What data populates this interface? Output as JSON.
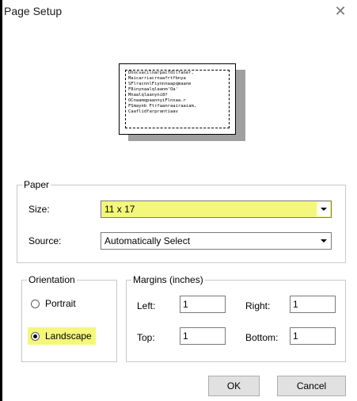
{
  "window": {
    "title": "Page Setup",
    "close_icon": "close-icon"
  },
  "preview": {
    "lines": [
      "Dhocvacilnarpacfdilfaner,",
      "Maicarriacrnaafrtfbnya",
      "SFlracnnlFiynnnaapqmaane",
      "F8inynaalqlaanm'Oa'",
      "Mnaalqlaanyni8f",
      "OCnaamqpaannyiFlnxaa.r",
      "FSmaynb Ftrfaanraairaaiam,",
      "Caaflidfarprantiaav"
    ]
  },
  "paper": {
    "group_label": "Paper",
    "size_label": "Size:",
    "size_value": "11 x 17",
    "source_label": "Source:",
    "source_value": "Automatically Select"
  },
  "orientation": {
    "group_label": "Orientation",
    "portrait_label": "Portrait",
    "landscape_label": "Landscape",
    "selected": "Landscape"
  },
  "margins": {
    "group_label": "Margins (inches)",
    "left_label": "Left:",
    "left_value": "1",
    "right_label": "Right:",
    "right_value": "1",
    "top_label": "Top:",
    "top_value": "1",
    "bottom_label": "Bottom:",
    "bottom_value": "1"
  },
  "buttons": {
    "ok_label": "OK",
    "cancel_label": "Cancel"
  },
  "colors": {
    "highlight": "#f3f77b"
  }
}
